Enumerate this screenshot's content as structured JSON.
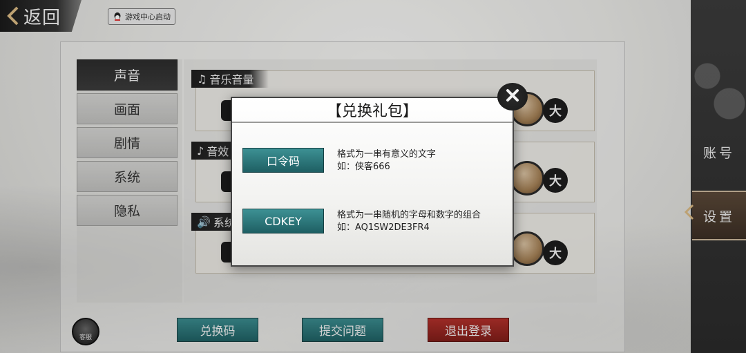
{
  "top": {
    "back_label": "返回",
    "game_center_label": "游戏中心启动"
  },
  "tabs": [
    {
      "label": "声音",
      "active": true
    },
    {
      "label": "画面",
      "active": false
    },
    {
      "label": "剧情",
      "active": false
    },
    {
      "label": "系统",
      "active": false
    },
    {
      "label": "隐私",
      "active": false
    }
  ],
  "sound_rows": {
    "music_title": "音乐音量",
    "effect_title": "音效",
    "system_title": "系统",
    "max_mark": "大"
  },
  "side_nav": {
    "account": "账号",
    "settings": "设置"
  },
  "bottom": {
    "customer_service": "客服",
    "redeem": "兑换码",
    "feedback": "提交问题",
    "logout": "退出登录"
  },
  "modal": {
    "title": "【兑换礼包】",
    "password_button": "口令码",
    "password_desc": "格式为一串有意义的文字",
    "password_example": "如：侠客666",
    "cdkey_button": "CDKEY",
    "cdkey_desc": "格式为一串随机的字母和数字的组合",
    "cdkey_example": "如：AQ1SW2DE3FR4"
  },
  "colors": {
    "teal": "#2e7a7d",
    "red": "#9e2722",
    "dark": "#2a2a2a"
  }
}
